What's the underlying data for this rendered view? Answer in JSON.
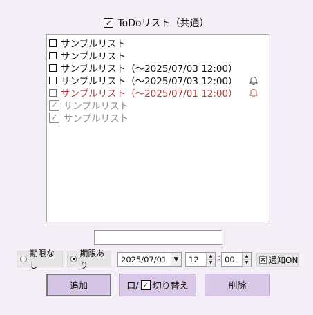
{
  "header": {
    "title": "ToDoリスト（共通）",
    "checked": true
  },
  "items": [
    {
      "text": "サンプルリスト",
      "state": "open"
    },
    {
      "text": "サンプルリスト",
      "state": "open"
    },
    {
      "text": "サンプルリスト（～2025/07/03 12:00）",
      "state": "open"
    },
    {
      "text": "サンプルリスト（～2025/07/03 12:00）",
      "state": "open",
      "bell": true,
      "bell_color": "#444444"
    },
    {
      "text": "サンプルリスト（～2025/07/01 12:00）",
      "state": "overdue",
      "bell": true,
      "bell_color": "#c0504d"
    },
    {
      "text": "サンプルリスト",
      "state": "done"
    },
    {
      "text": "サンプルリスト",
      "state": "done"
    }
  ],
  "input": {
    "value": ""
  },
  "deadline": {
    "none_label": "期限なし",
    "with_label": "期限あり",
    "selected": "with",
    "date": "2025/07/01",
    "hour": "12",
    "minute": "00",
    "colon": ":",
    "notify_label": "通知ON",
    "notify_checked": true
  },
  "buttons": {
    "add": "追加",
    "toggle_prefix": "口/",
    "toggle_suffix": "切り替え",
    "delete": "削除"
  },
  "colors": {
    "background": "#f4eff7",
    "button": "#d8c8e6",
    "overdue": "#b33a3a",
    "done": "#8f8f8f"
  }
}
